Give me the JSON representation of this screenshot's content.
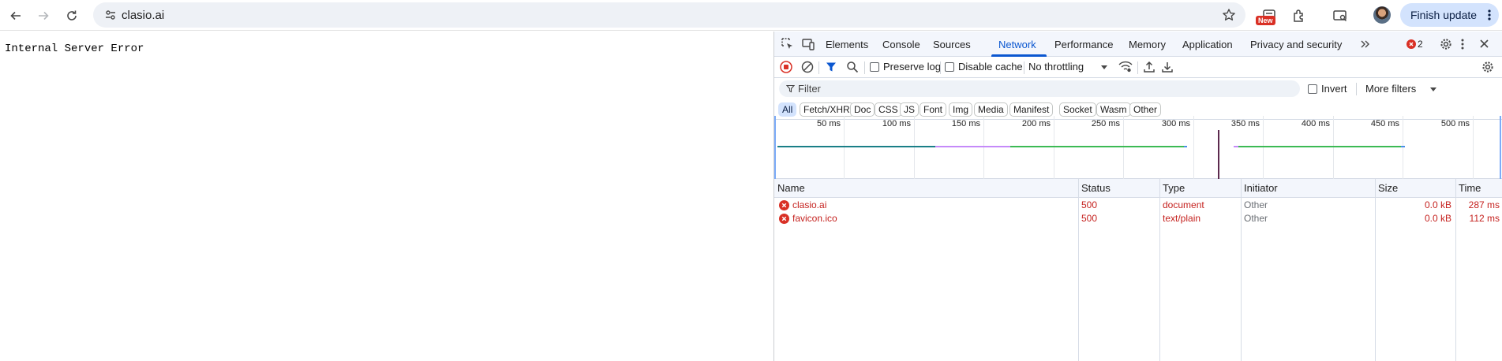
{
  "browser": {
    "url": "clasio.ai",
    "new_badge": "New",
    "finish_update": "Finish update"
  },
  "page": {
    "error_text": "Internal Server Error"
  },
  "devtools": {
    "tabs": [
      "Elements",
      "Console",
      "Sources",
      "Network",
      "Performance",
      "Memory",
      "Application",
      "Privacy and security"
    ],
    "active_tab": "Network",
    "error_count": "2",
    "toolbar": {
      "preserve_log": "Preserve log",
      "disable_cache": "Disable cache",
      "throttling": "No throttling"
    },
    "filter": {
      "placeholder": "Filter",
      "invert": "Invert",
      "more_filters": "More filters"
    },
    "type_filters": [
      "All",
      "Fetch/XHR",
      "Doc",
      "CSS",
      "JS",
      "Font",
      "Img",
      "Media",
      "Manifest",
      "Socket",
      "Wasm",
      "Other"
    ],
    "timeline_ticks": [
      "50 ms",
      "100 ms",
      "150 ms",
      "200 ms",
      "250 ms",
      "300 ms",
      "350 ms",
      "400 ms",
      "450 ms",
      "500 ms"
    ],
    "columns": [
      "Name",
      "Status",
      "Type",
      "Initiator",
      "Size",
      "Time"
    ],
    "requests": [
      {
        "name": "clasio.ai",
        "status": "500",
        "type": "document",
        "initiator": "Other",
        "size": "0.0 kB",
        "time": "287 ms"
      },
      {
        "name": "favicon.ico",
        "status": "500",
        "type": "text/plain",
        "initiator": "Other",
        "size": "0.0 kB",
        "time": "112 ms"
      }
    ],
    "colors": {
      "accent": "#0b57d0",
      "error": "#c5221f",
      "waiting": "#1a7f87",
      "download": "#3cba54",
      "receive": "#c58af9"
    }
  }
}
